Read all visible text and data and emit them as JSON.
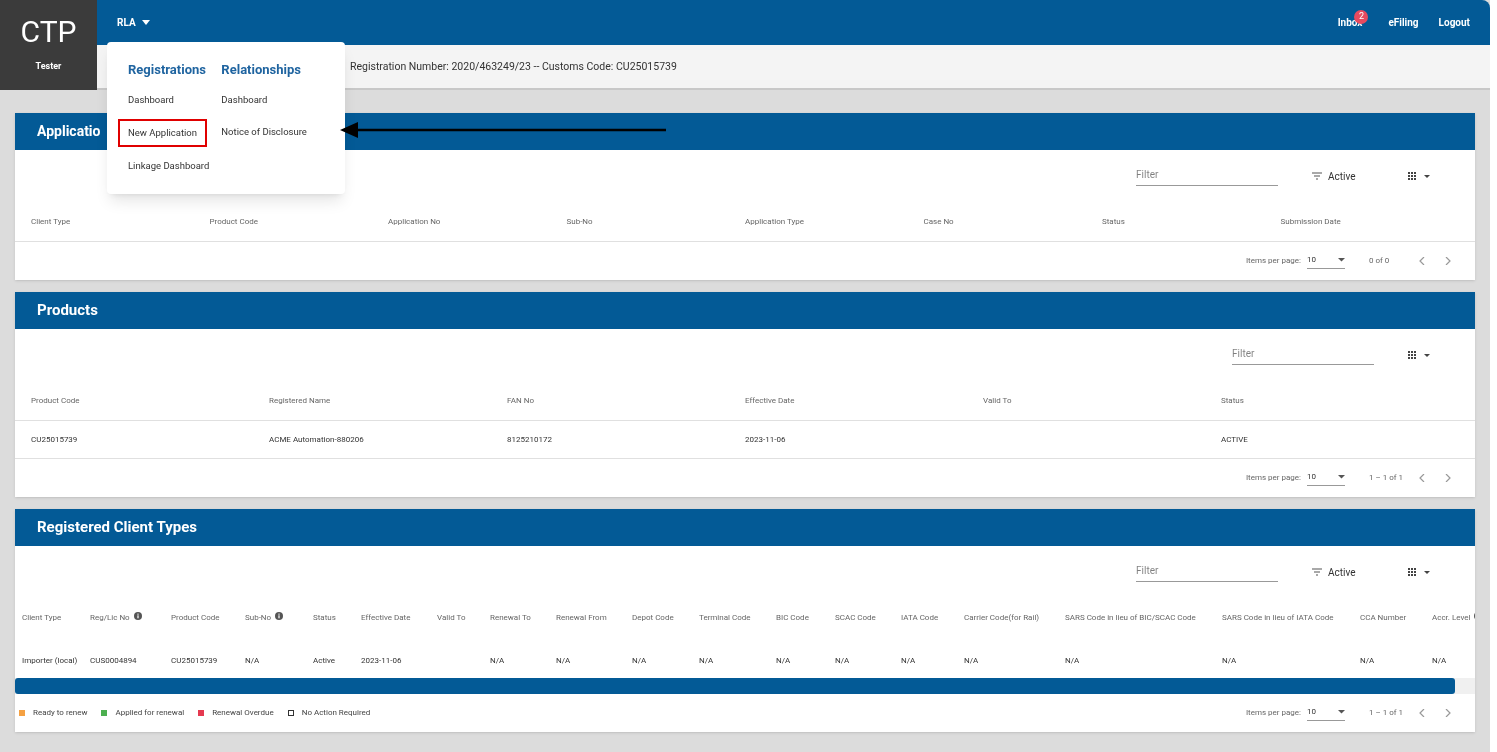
{
  "app": {
    "logo": "CTP",
    "user": "Tester"
  },
  "top_nav": {
    "menu": "RLA",
    "links": [
      {
        "label": "Inbox",
        "badge": "2"
      },
      {
        "label": "eFiling"
      },
      {
        "label": "Logout"
      }
    ]
  },
  "info_bar": "Registration Number: 2020/463249/23 -- Customs Code: CU25015739",
  "menu_dropdown": {
    "columns": [
      {
        "heading": "Registrations",
        "items": [
          {
            "label": "Dashboard",
            "highlighted": false
          },
          {
            "label": "New Application",
            "highlighted": true
          },
          {
            "label": "Linkage Dashboard",
            "highlighted": false
          }
        ]
      },
      {
        "heading": "Relationships",
        "items": [
          {
            "label": "Dashboard",
            "highlighted": false
          },
          {
            "label": "Notice of Disclosure",
            "highlighted": false
          }
        ]
      }
    ]
  },
  "panels": [
    {
      "title": "Applicatio",
      "filter_placeholder": "Filter",
      "status_filter": "Active",
      "columns": [
        {
          "label": "Client Type"
        },
        {
          "label": "Product Code"
        },
        {
          "label": "Application No"
        },
        {
          "label": "Sub-No"
        },
        {
          "label": "Application Type"
        },
        {
          "label": "Case No"
        },
        {
          "label": "Status"
        },
        {
          "label": "Submission Date"
        }
      ],
      "paginator": {
        "label": "Items per page:",
        "page_size": "10",
        "range": "0 of 0"
      }
    },
    {
      "title": "Products",
      "filter_placeholder": "Filter",
      "columns": [
        {
          "label": "Product Code"
        },
        {
          "label": "Registered Name"
        },
        {
          "label": "FAN No"
        },
        {
          "label": "Effective Date"
        },
        {
          "label": "Valid To"
        },
        {
          "label": "Status"
        }
      ],
      "rows": [
        [
          "CU25015739",
          "ACME Automation-880206",
          "8125210172",
          "2023-11-06",
          "",
          "ACTIVE"
        ]
      ],
      "paginator": {
        "label": "Items per page:",
        "page_size": "10",
        "range": "1 – 1 of 1"
      }
    },
    {
      "title": "Registered Client Types",
      "filter_placeholder": "Filter",
      "status_filter": "Active",
      "columns": [
        {
          "label": "Client Type"
        },
        {
          "label": "Reg/Lic No",
          "info": true
        },
        {
          "label": "Product Code"
        },
        {
          "label": "Sub-No",
          "info": true
        },
        {
          "label": "Status"
        },
        {
          "label": "Effective Date"
        },
        {
          "label": "Valid To"
        },
        {
          "label": "Renewal To"
        },
        {
          "label": "Renewal From"
        },
        {
          "label": "Depot Code"
        },
        {
          "label": "Terminal Code"
        },
        {
          "label": "BIC Code"
        },
        {
          "label": "SCAC Code"
        },
        {
          "label": "IATA Code"
        },
        {
          "label": "Carrier Code(for Rail)"
        },
        {
          "label": "SARS Code in lieu of BIC/SCAC Code"
        },
        {
          "label": "SARS Code in lieu of IATA Code"
        },
        {
          "label": "CCA Number"
        },
        {
          "label": "Accr. Level",
          "info": true
        }
      ],
      "rows": [
        [
          "Importer (local)",
          "CUS0004894",
          "CU25015739",
          "N/A",
          "Active",
          "2023-11-06",
          "",
          "N/A",
          "N/A",
          "N/A",
          "N/A",
          "N/A",
          "N/A",
          "N/A",
          "N/A",
          "N/A",
          "N/A",
          "N/A",
          "N/A"
        ]
      ],
      "legend": [
        {
          "label": "Ready to renew",
          "color": "#f5a142"
        },
        {
          "label": "Applied for renewal",
          "color": "#4caf50"
        },
        {
          "label": "Renewal Overdue",
          "color": "#e53950"
        },
        {
          "label": "No Action Required",
          "color": "#ffffff"
        }
      ],
      "paginator": {
        "label": "Items per page:",
        "page_size": "10",
        "range": "1 – 1 of 1"
      }
    }
  ]
}
